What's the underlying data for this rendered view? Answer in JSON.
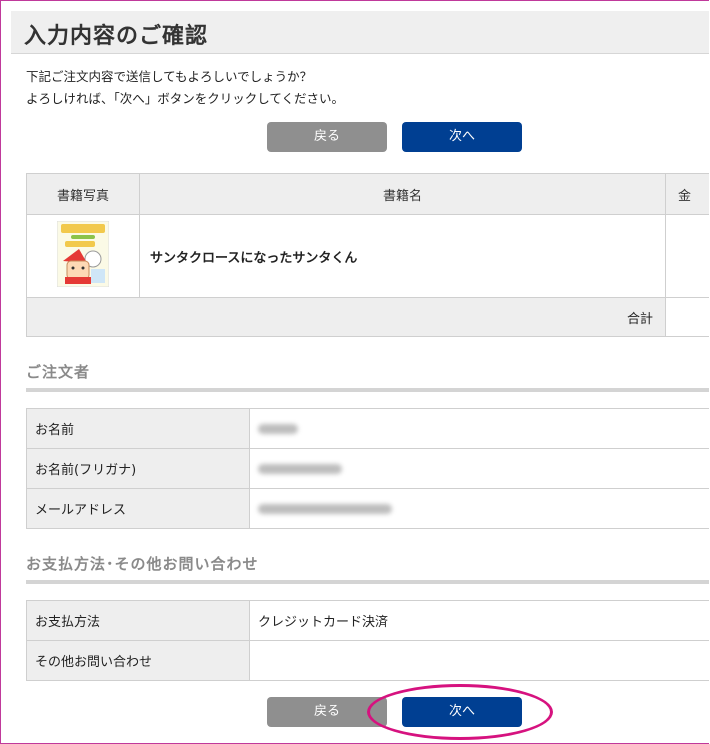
{
  "page": {
    "title": "入力内容のご確認",
    "intro_line1": "下記ご注文内容で送信してもよろしいでしょうか？",
    "intro_line2": "よろしければ、「次へ」ボタンをクリックしてください。"
  },
  "buttons": {
    "back_label": "戻る",
    "next_label": "次へ"
  },
  "books_table": {
    "headers": [
      "書籍写真",
      "書籍名",
      "金"
    ],
    "rows": [
      {
        "title": "サンタクロースになったサンタくん"
      }
    ],
    "total_label": "合計"
  },
  "orderer": {
    "section_title": "ご注文者",
    "rows": [
      {
        "label": "お名前"
      },
      {
        "label": "お名前(フリガナ)"
      },
      {
        "label": "メールアドレス"
      }
    ]
  },
  "payment": {
    "section_title": "お支払方法･その他お問い合わせ",
    "rows": [
      {
        "label": "お支払方法",
        "value": "クレジットカード決済"
      },
      {
        "label": "その他お問い合わせ",
        "value": ""
      }
    ]
  },
  "colors": {
    "next_button": "#003f92",
    "back_button": "#8f8f8f",
    "highlight": "#d6127f"
  }
}
